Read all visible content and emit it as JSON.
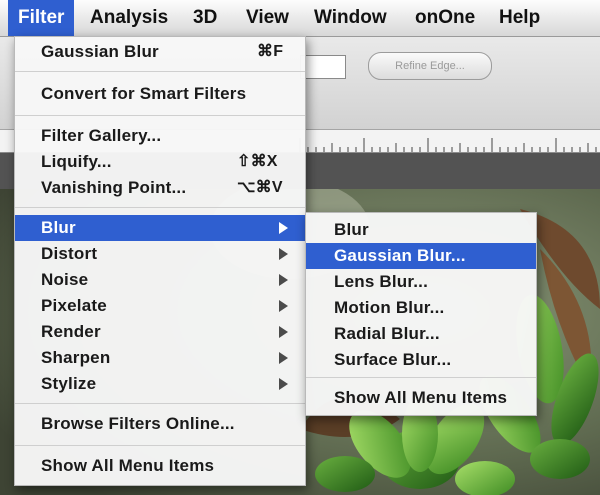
{
  "menubar": {
    "items": [
      "Filter",
      "Analysis",
      "3D",
      "View",
      "Window",
      "onOne",
      "Help"
    ]
  },
  "options_bar": {
    "refine_edge_label": "Refine Edge..."
  },
  "filter_menu": {
    "gaussian_blur": {
      "label": "Gaussian Blur",
      "shortcut": "⌘F"
    },
    "convert_smart": {
      "label": "Convert for Smart Filters"
    },
    "filter_gallery": {
      "label": "Filter Gallery..."
    },
    "liquify": {
      "label": "Liquify...",
      "shortcut": "⇧⌘X"
    },
    "vanishing_point": {
      "label": "Vanishing Point...",
      "shortcut": "⌥⌘V"
    },
    "submenus": [
      "Blur",
      "Distort",
      "Noise",
      "Pixelate",
      "Render",
      "Sharpen",
      "Stylize"
    ],
    "browse_online": {
      "label": "Browse Filters Online..."
    },
    "show_all": {
      "label": "Show All Menu Items"
    }
  },
  "blur_submenu": {
    "items": [
      "Blur",
      "Gaussian Blur...",
      "Lens Blur...",
      "Motion Blur...",
      "Radial Blur...",
      "Surface Blur..."
    ],
    "show_all": "Show All Menu Items"
  },
  "colors": {
    "highlight": "#2f5fd0",
    "menu_bg": "#f7f7f7"
  }
}
